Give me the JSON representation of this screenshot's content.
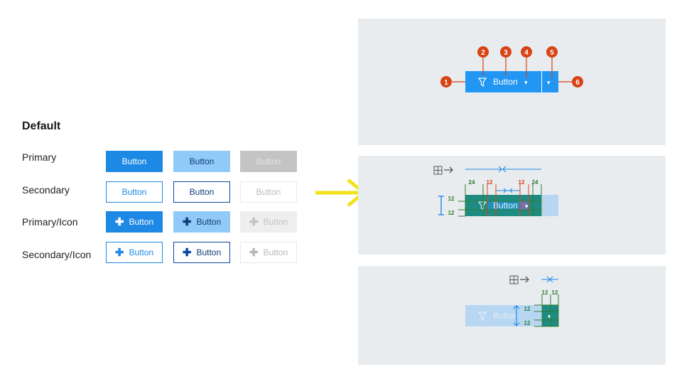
{
  "section_title": "Default",
  "rows": [
    {
      "label": "Primary"
    },
    {
      "label": "Secondary"
    },
    {
      "label": "Primary/Icon"
    },
    {
      "label": "Secondary/Icon"
    }
  ],
  "button_label": "Button",
  "plus_glyph": "✚",
  "callouts": [
    "1",
    "2",
    "3",
    "4",
    "5",
    "6"
  ],
  "dropdown_glyph": "▾",
  "spacing_full": [
    "24",
    "12",
    "12",
    "24",
    "12",
    "12"
  ],
  "spacing_compact": [
    "12",
    "12",
    "12",
    "12"
  ],
  "colors": {
    "primary": "#1e88e5",
    "primary_light": "#90caf9",
    "callout": "#d84315",
    "spacing_green": "#2e7d32",
    "spacing_orange": "#d84315",
    "arrow_yellow": "#f2e21a",
    "overlay_teal": "#1e8c82"
  }
}
